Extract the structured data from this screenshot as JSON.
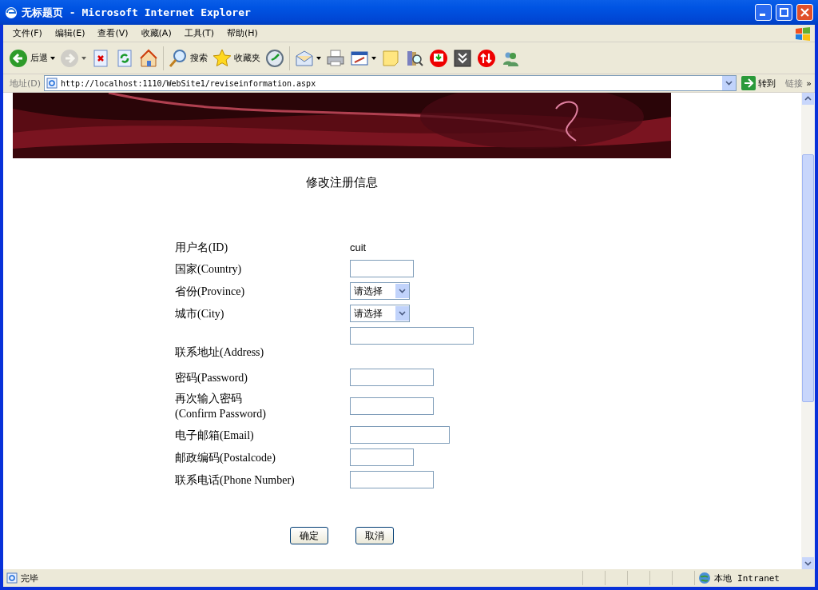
{
  "window": {
    "title": "无标题页 - Microsoft Internet Explorer"
  },
  "menu": [
    "文件(F)",
    "编辑(E)",
    "查看(V)",
    "收藏(A)",
    "工具(T)",
    "帮助(H)"
  ],
  "toolbar": [
    {
      "kind": "back",
      "label": "后退",
      "dropdown": true,
      "disabled": false
    },
    {
      "kind": "forward",
      "dropdown": true,
      "disabled": true
    },
    {
      "kind": "stop",
      "dropdown": false,
      "disabled": false
    },
    {
      "kind": "refresh",
      "dropdown": false,
      "disabled": false
    },
    {
      "kind": "home",
      "dropdown": false,
      "disabled": false
    },
    {
      "kind": "search",
      "label": "搜索",
      "dropdown": false,
      "disabled": false
    },
    {
      "kind": "favorites",
      "label": "收藏夹",
      "dropdown": false,
      "disabled": false
    },
    {
      "kind": "history",
      "dropdown": false,
      "disabled": false
    },
    {
      "kind": "mail",
      "dropdown": true,
      "disabled": false
    },
    {
      "kind": "print",
      "dropdown": false,
      "disabled": false
    },
    {
      "kind": "edit",
      "dropdown": true,
      "disabled": false
    },
    {
      "kind": "note",
      "dropdown": false,
      "disabled": false
    },
    {
      "kind": "research",
      "dropdown": false,
      "disabled": false
    },
    {
      "kind": "download",
      "dropdown": false,
      "disabled": false
    },
    {
      "kind": "chevrons",
      "dropdown": false,
      "disabled": false
    },
    {
      "kind": "updown",
      "dropdown": false,
      "disabled": false
    },
    {
      "kind": "messenger",
      "dropdown": false,
      "disabled": false
    }
  ],
  "address_bar": {
    "label": "地址(D)",
    "url": "http://localhost:1110/WebSite1/reviseinformation.aspx",
    "go": "转到",
    "links": "链接",
    "more": "»"
  },
  "page": {
    "heading": "修改注册信息",
    "form": [
      {
        "kind": "static",
        "label": "用户名(ID)",
        "value": "cuit"
      },
      {
        "kind": "text",
        "label": "国家(Country)"
      },
      {
        "kind": "select",
        "label": "省份(Province)",
        "value": "请选择"
      },
      {
        "kind": "select",
        "label": "城市(City)",
        "value": "请选择"
      },
      {
        "kind": "text",
        "label": "联系地址(Address)"
      },
      {
        "kind": "text",
        "label": "密码(Password)"
      },
      {
        "kind": "text",
        "label": "再次输入密码\n(Confirm Password)"
      },
      {
        "kind": "text",
        "label": "电子邮箱(Email)"
      },
      {
        "kind": "text",
        "label": "邮政编码(Postalcode)"
      },
      {
        "kind": "text",
        "label": "联系电话(Phone Number)"
      }
    ],
    "buttons": [
      "确定",
      "取消"
    ]
  },
  "status_bar": {
    "text": "完毕",
    "zone": "本地 Intranet"
  }
}
